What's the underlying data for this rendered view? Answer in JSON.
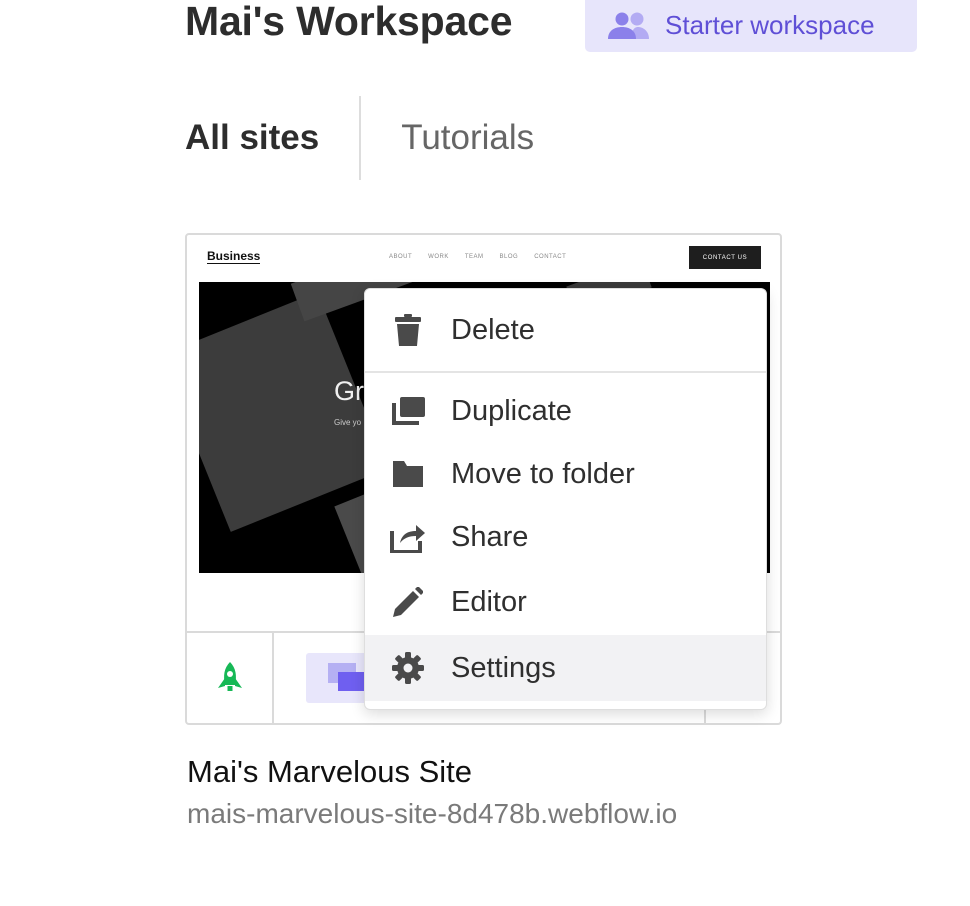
{
  "workspace": {
    "title": "Mai's Workspace",
    "plan_badge": {
      "label": "Starter workspace",
      "icon": "users-icon",
      "color": "#5f4fd6",
      "background": "#e7e5fb"
    }
  },
  "tabs": [
    {
      "label": "All sites",
      "active": true
    },
    {
      "label": "Tutorials",
      "active": false
    }
  ],
  "site_card": {
    "thumbnail": {
      "logo": "Business",
      "nav_links": [
        "ABOUT",
        "WORK",
        "TEAM",
        "BLOG",
        "CONTACT"
      ],
      "cta": "CONTACT US",
      "hero_headline": "Gr",
      "hero_subtext": "Give yo"
    },
    "publish_icon": "rocket-icon",
    "publish_icon_color": "#17b856",
    "designer_icon": "designer-icon"
  },
  "context_menu": {
    "items": [
      {
        "label": "Delete",
        "icon": "trash-icon"
      },
      {
        "label": "Duplicate",
        "icon": "duplicate-icon"
      },
      {
        "label": "Move to folder",
        "icon": "folder-icon"
      },
      {
        "label": "Share",
        "icon": "share-icon"
      },
      {
        "label": "Editor",
        "icon": "pencil-icon"
      },
      {
        "label": "Settings",
        "icon": "gear-icon",
        "highlighted": true
      }
    ]
  },
  "site": {
    "name": "Mai's Marvelous Site",
    "url": "mais-marvelous-site-8d478b.webflow.io"
  }
}
